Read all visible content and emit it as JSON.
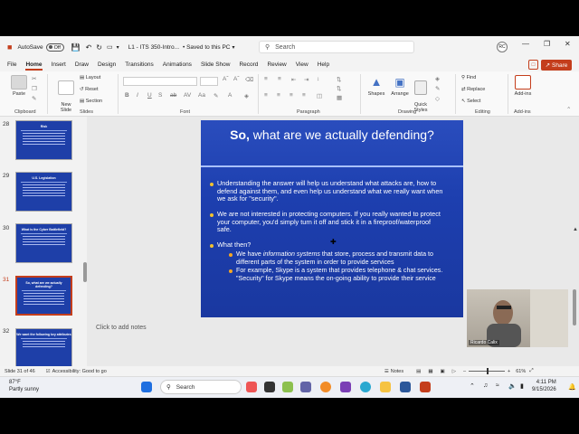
{
  "titlebar": {
    "autosave_label": "AutoSave",
    "autosave_state": "Off",
    "doc_title": "L1 - ITS 350-Intro...",
    "saved_status": "• Saved to this PC",
    "search_placeholder": "Search",
    "user_initials": "RC"
  },
  "menu": [
    "File",
    "Home",
    "Insert",
    "Draw",
    "Design",
    "Transitions",
    "Animations",
    "Slide Show",
    "Record",
    "Review",
    "View",
    "Help"
  ],
  "share_label": "Share",
  "ribbon": {
    "paste": "Paste",
    "new_slide": "New\nSlide",
    "layout": "Layout",
    "reset": "Reset",
    "section": "Section",
    "shapes": "Shapes",
    "arrange": "Arrange",
    "quick_styles": "Quick\nStyles",
    "find": "Find",
    "replace": "Replace",
    "select": "Select",
    "addins": "Add-ins",
    "groups": [
      "Clipboard",
      "Slides",
      "Font",
      "Paragraph",
      "Drawing",
      "Editing",
      "Add-ins"
    ]
  },
  "thumbnails": [
    {
      "num": "28",
      "title": "Risk"
    },
    {
      "num": "29",
      "title": "U.S. Legislation"
    },
    {
      "num": "30",
      "title": "What is the Cyber Battlefield?"
    },
    {
      "num": "31",
      "title": "So, what are we actually defending?"
    },
    {
      "num": "32",
      "title": "We want the following key attributes"
    }
  ],
  "slide": {
    "title_bold": "So,",
    "title_rest": " what are we actually defending?",
    "bullet1": "Understanding the answer will help us understand what attacks are, how to defend against them, and even help us understand what we really want when we ask for \"security\".",
    "bullet2": "We are not interested in protecting computers. If you really wanted to protect your computer, you'd simply turn it off and stick it in a fireproof/waterproof safe.",
    "bullet3": "What then?",
    "sub1_a": "We have ",
    "sub1_em": "information systems",
    "sub1_b": " that store, process and transmit data to different parts of the system in order to provide services",
    "sub2": "For example, Skype is a system that provides telephone & chat services. \"Security\" for Skype means the on-going ability to provide their service"
  },
  "notes_placeholder": "Click to add notes",
  "video_name": "Ricardo Calix",
  "status": {
    "slide_of": "Slide 31 of 46",
    "accessibility": "Accessibility: Good to go",
    "notes": "Notes",
    "zoom": "61%"
  },
  "taskbar": {
    "temp": "87°F",
    "weather": "Partly sunny",
    "search": "Search",
    "time": "4:11 PM",
    "date": "9/15/2026"
  }
}
